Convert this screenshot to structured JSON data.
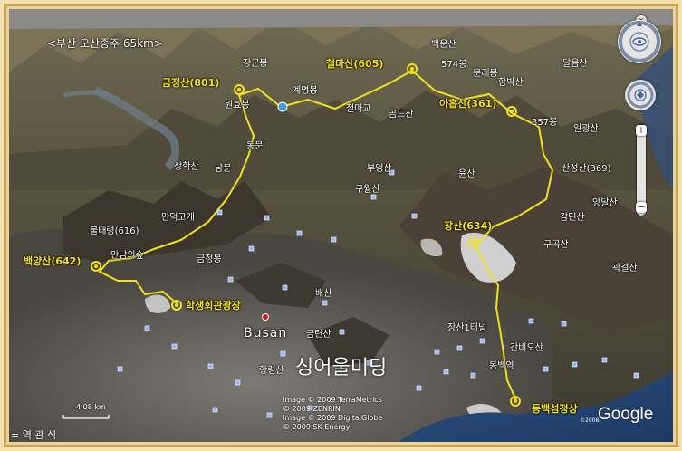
{
  "header": {
    "distance_label": "<부산 오산종주 65km>"
  },
  "sign_text": "싱어울미딩",
  "city_label": "Busan",
  "peaks": [
    {
      "id": "geumjeongsan",
      "label": "금정산(801)"
    },
    {
      "id": "cheolmasan",
      "label": "철마산(605)"
    },
    {
      "id": "ahopsan",
      "label": "아홉산(361)"
    },
    {
      "id": "jangsan",
      "label": "장산(634)"
    },
    {
      "id": "baegyangsan",
      "label": "백양산(642)"
    },
    {
      "id": "haksaeng",
      "label": "학생회관광장"
    },
    {
      "id": "dongbaek",
      "label": "동백섬정상"
    }
  ],
  "places": [
    "장군봉",
    "계명봉",
    "원효봉",
    "동문",
    "상학산",
    "남문",
    "만덕고개",
    "불태령(616)",
    "만남의숲",
    "금정봉",
    "배산",
    "금련산",
    "황령산",
    "구월산",
    "부엉산",
    "윤산",
    "백운산",
    "574봉",
    "문래봉",
    "철마교",
    "곰드산",
    "함박산",
    "일광산",
    "357봉",
    "달음산",
    "산성산(369)",
    "양달산",
    "감딘산",
    "구곡산",
    "곽걸산",
    "장산1터널",
    "간비오산",
    "동백역"
  ],
  "copyright_lines": [
    "Image © 2009 TerraMetrics",
    "© 2009 ZENRIN",
    "Image © 2009 DigitalGlobe",
    "© 2009 SK Energy"
  ],
  "scale_label": "4.08 km",
  "bottom_left_text": "= 역 관 식",
  "google": {
    "logo": "Google",
    "year": "©2008"
  },
  "controls": {
    "close_icon": "×",
    "zoom_in": "+",
    "zoom_out": "−",
    "nav_icon": "compass-ring",
    "look_icon": "eye-look"
  }
}
